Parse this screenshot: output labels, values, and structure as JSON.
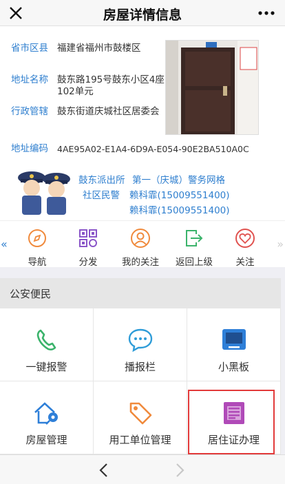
{
  "header": {
    "title": "房屋详情信息"
  },
  "info": {
    "rows": [
      {
        "label": "省市区县",
        "value": "福建省福州市鼓楼区"
      },
      {
        "label": "地址名称",
        "value": "鼓东路195号鼓东小区4座102单元"
      },
      {
        "label": "行政管辖",
        "value": "鼓东街道庆城社区居委会"
      },
      {
        "label": "地址编码",
        "value": "4AE95A02-E1A4-6D9A-E054-90E2BA510A0C"
      }
    ]
  },
  "police": {
    "station": "鼓东派出所",
    "grid": "第一（庆城）警务网格",
    "officer_label": "社区民警",
    "officers": [
      "赖科霏(15009551400)",
      "赖科霏(15009551400)"
    ]
  },
  "strip": {
    "items": [
      {
        "label": "导航",
        "icon": "compass-icon"
      },
      {
        "label": "分发",
        "icon": "qrcode-icon"
      },
      {
        "label": "我的关注",
        "icon": "person-icon"
      },
      {
        "label": "返回上级",
        "icon": "exit-icon"
      },
      {
        "label": "关注",
        "icon": "heart-icon"
      }
    ]
  },
  "section": {
    "title": "公安便民"
  },
  "grid": {
    "items": [
      {
        "label": "一键报警",
        "icon": "phone-icon",
        "color": "#3bb36b"
      },
      {
        "label": "播报栏",
        "icon": "chat-icon",
        "color": "#2e9cd8"
      },
      {
        "label": "小黑板",
        "icon": "blackboard-icon",
        "color": "#2e7fd8"
      },
      {
        "label": "房屋管理",
        "icon": "house-key-icon",
        "color": "#2e7fd8"
      },
      {
        "label": "用工单位管理",
        "icon": "tag-icon",
        "color": "#f08a3c"
      },
      {
        "label": "居住证办理",
        "icon": "document-icon",
        "color": "#b04ab8"
      }
    ]
  },
  "colors": {
    "accent": "#2f7fcf",
    "highlight": "#e23a3a"
  }
}
